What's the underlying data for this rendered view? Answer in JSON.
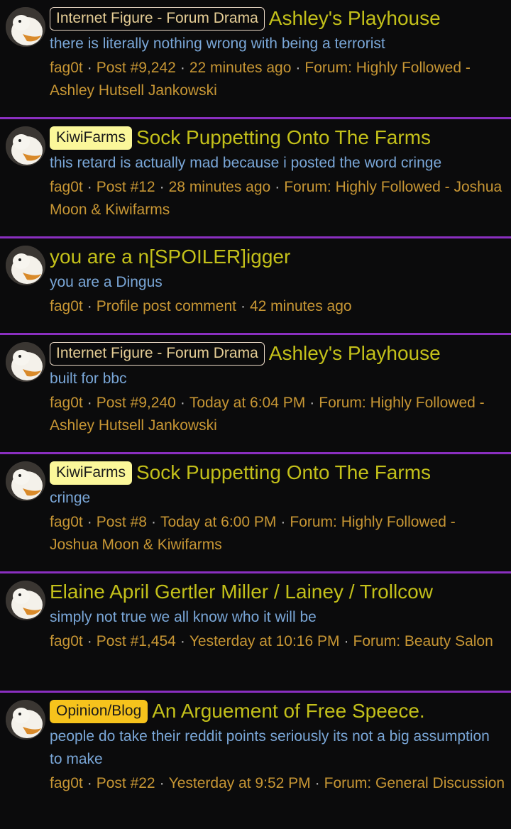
{
  "results": [
    {
      "badge": "Internet Figure - Forum Drama",
      "badge_style": "outline",
      "title": "Ashley's Playhouse",
      "snippet": "there is literally nothing wrong with being a terrorist",
      "author": "fag0t",
      "post": "Post #9,242",
      "time": "22 minutes ago",
      "forum": "Forum: Highly Followed - Ashley Hutsell Jankowski"
    },
    {
      "badge": "KiwiFarms",
      "badge_style": "yellow",
      "title": "Sock Puppetting Onto The Farms",
      "snippet": "this retard is actually mad because i posted the word cringe",
      "author": "fag0t",
      "post": "Post #12",
      "time": "28 minutes ago",
      "forum": "Forum: Highly Followed - Joshua Moon & Kiwifarms"
    },
    {
      "badge": "",
      "badge_style": "",
      "title": "you are a n[SPOILER]igger",
      "snippet": "you are a Dingus",
      "author": "fag0t",
      "post": "Profile post comment",
      "time": "42 minutes ago",
      "forum": ""
    },
    {
      "badge": "Internet Figure - Forum Drama",
      "badge_style": "outline",
      "title": "Ashley's Playhouse",
      "snippet": "built for bbc",
      "author": "fag0t",
      "post": "Post #9,240",
      "time": "Today at 6:04 PM",
      "forum": "Forum: Highly Followed - Ashley Hutsell Jankowski"
    },
    {
      "badge": "KiwiFarms",
      "badge_style": "yellow",
      "title": "Sock Puppetting Onto The Farms",
      "snippet": "cringe",
      "author": "fag0t",
      "post": "Post #8",
      "time": "Today at 6:00 PM",
      "forum": "Forum: Highly Followed - Joshua Moon & Kiwifarms"
    },
    {
      "badge": "",
      "badge_style": "",
      "title": "Elaine April Gertler Miller / Lainey / Trollcow",
      "snippet": "simply not true we all know who it will be",
      "author": "fag0t",
      "post": "Post #1,454",
      "time": "Yesterday at 10:16 PM",
      "forum": "Forum: Beauty Salon"
    },
    {
      "badge": "Opinion/Blog",
      "badge_style": "orange",
      "title": "An Arguement of Free Speece.",
      "snippet": "people do take their reddit points seriously its not a big assumption to make",
      "author": "fag0t",
      "post": "Post #22",
      "time": "Yesterday at 9:52 PM",
      "forum": "Forum: General Discussion"
    }
  ],
  "colors": {
    "title": "#c3c01a",
    "snippet": "#7aa7d8",
    "meta": "#c79634",
    "divider": "#8a2fc0",
    "background": "#0b0b0c"
  },
  "icons": {
    "avatar": "white-duck-avatar"
  }
}
